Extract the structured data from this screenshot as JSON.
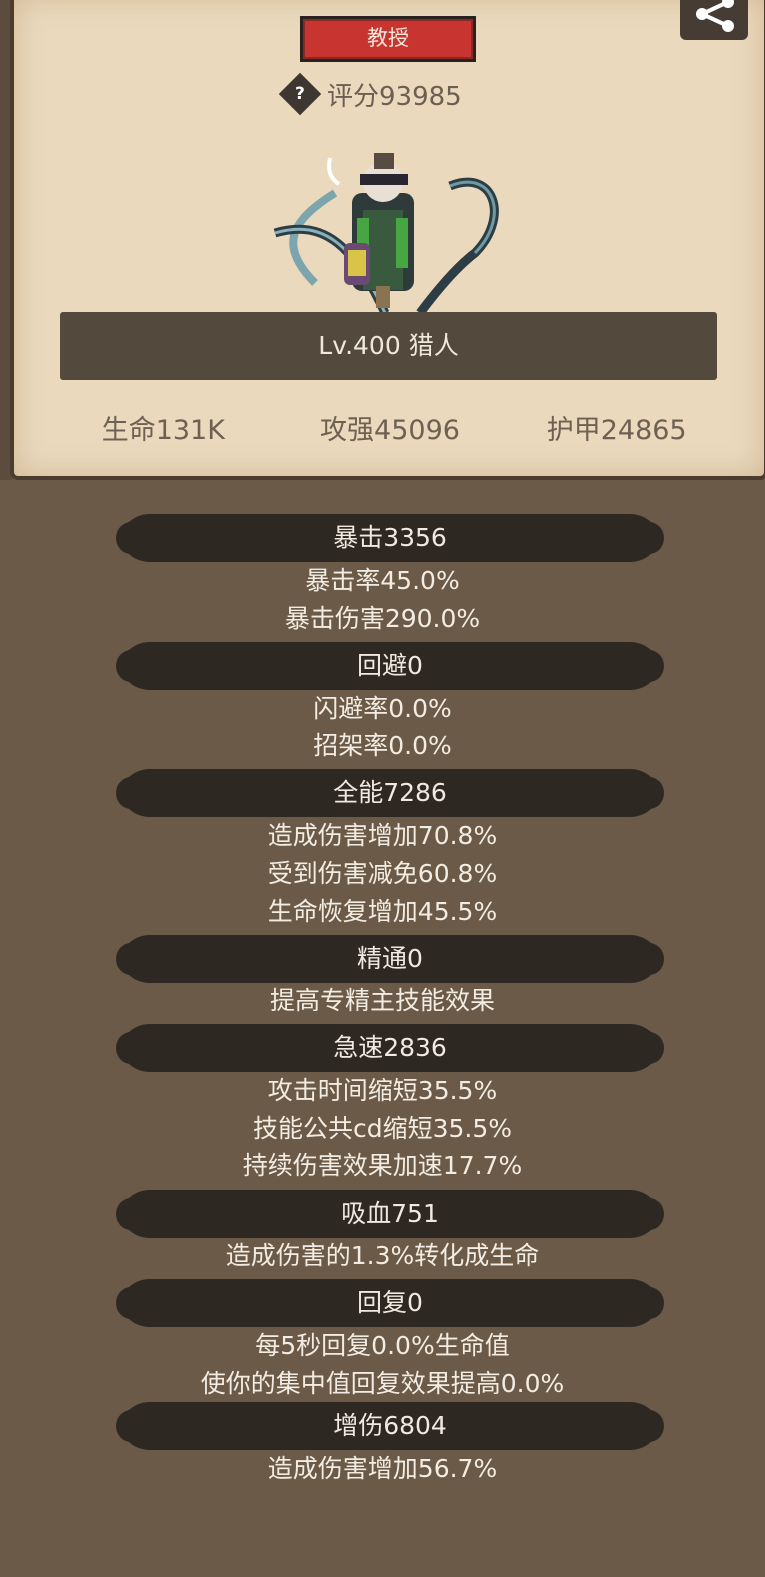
{
  "header": {
    "title_badge": "教授",
    "score_label": "评分93985",
    "level_name": "Lv.400 猎人",
    "stats": [
      "生命131K",
      "攻强45096",
      "护甲24865"
    ]
  },
  "attributes": [
    {
      "title": "暴击3356",
      "lines": [
        "暴击率45.0%",
        "暴击伤害290.0%"
      ]
    },
    {
      "title": "回避0",
      "lines": [
        "闪避率0.0%",
        "招架率0.0%"
      ]
    },
    {
      "title": "全能7286",
      "lines": [
        "造成伤害增加70.8%",
        "受到伤害减免60.8%",
        "生命恢复增加45.5%"
      ]
    },
    {
      "title": "精通0",
      "lines": [
        "提高专精主技能效果"
      ]
    },
    {
      "title": "急速2836",
      "lines": [
        "攻击时间缩短35.5%",
        "技能公共cd缩短35.5%",
        "持续伤害效果加速17.7%"
      ]
    },
    {
      "title": "吸血751",
      "lines": [
        "造成伤害的1.3%转化成生命"
      ]
    },
    {
      "title": "回复0",
      "lines": [
        "每5秒回复0.0%生命值",
        "使你的集中值回复效果提高0.0%"
      ]
    },
    {
      "title": "增伤6804",
      "lines": [
        "造成伤害增加56.7%"
      ]
    }
  ],
  "icons": [
    "question-icon",
    "share-icon"
  ]
}
